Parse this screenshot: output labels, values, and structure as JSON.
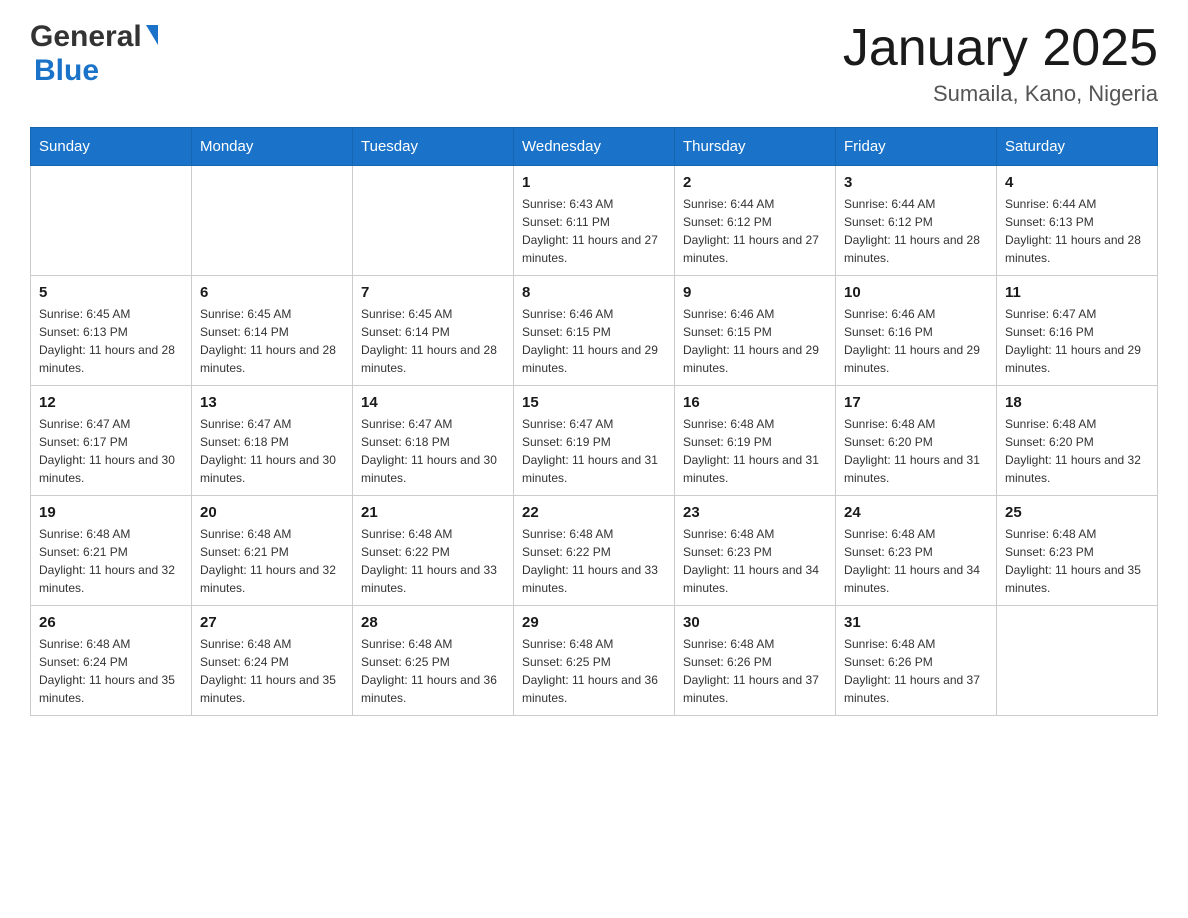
{
  "header": {
    "logo_general": "General",
    "logo_blue": "Blue",
    "month_title": "January 2025",
    "location": "Sumaila, Kano, Nigeria"
  },
  "days_of_week": [
    "Sunday",
    "Monday",
    "Tuesday",
    "Wednesday",
    "Thursday",
    "Friday",
    "Saturday"
  ],
  "weeks": [
    [
      {
        "day": "",
        "info": ""
      },
      {
        "day": "",
        "info": ""
      },
      {
        "day": "",
        "info": ""
      },
      {
        "day": "1",
        "info": "Sunrise: 6:43 AM\nSunset: 6:11 PM\nDaylight: 11 hours and 27 minutes."
      },
      {
        "day": "2",
        "info": "Sunrise: 6:44 AM\nSunset: 6:12 PM\nDaylight: 11 hours and 27 minutes."
      },
      {
        "day": "3",
        "info": "Sunrise: 6:44 AM\nSunset: 6:12 PM\nDaylight: 11 hours and 28 minutes."
      },
      {
        "day": "4",
        "info": "Sunrise: 6:44 AM\nSunset: 6:13 PM\nDaylight: 11 hours and 28 minutes."
      }
    ],
    [
      {
        "day": "5",
        "info": "Sunrise: 6:45 AM\nSunset: 6:13 PM\nDaylight: 11 hours and 28 minutes."
      },
      {
        "day": "6",
        "info": "Sunrise: 6:45 AM\nSunset: 6:14 PM\nDaylight: 11 hours and 28 minutes."
      },
      {
        "day": "7",
        "info": "Sunrise: 6:45 AM\nSunset: 6:14 PM\nDaylight: 11 hours and 28 minutes."
      },
      {
        "day": "8",
        "info": "Sunrise: 6:46 AM\nSunset: 6:15 PM\nDaylight: 11 hours and 29 minutes."
      },
      {
        "day": "9",
        "info": "Sunrise: 6:46 AM\nSunset: 6:15 PM\nDaylight: 11 hours and 29 minutes."
      },
      {
        "day": "10",
        "info": "Sunrise: 6:46 AM\nSunset: 6:16 PM\nDaylight: 11 hours and 29 minutes."
      },
      {
        "day": "11",
        "info": "Sunrise: 6:47 AM\nSunset: 6:16 PM\nDaylight: 11 hours and 29 minutes."
      }
    ],
    [
      {
        "day": "12",
        "info": "Sunrise: 6:47 AM\nSunset: 6:17 PM\nDaylight: 11 hours and 30 minutes."
      },
      {
        "day": "13",
        "info": "Sunrise: 6:47 AM\nSunset: 6:18 PM\nDaylight: 11 hours and 30 minutes."
      },
      {
        "day": "14",
        "info": "Sunrise: 6:47 AM\nSunset: 6:18 PM\nDaylight: 11 hours and 30 minutes."
      },
      {
        "day": "15",
        "info": "Sunrise: 6:47 AM\nSunset: 6:19 PM\nDaylight: 11 hours and 31 minutes."
      },
      {
        "day": "16",
        "info": "Sunrise: 6:48 AM\nSunset: 6:19 PM\nDaylight: 11 hours and 31 minutes."
      },
      {
        "day": "17",
        "info": "Sunrise: 6:48 AM\nSunset: 6:20 PM\nDaylight: 11 hours and 31 minutes."
      },
      {
        "day": "18",
        "info": "Sunrise: 6:48 AM\nSunset: 6:20 PM\nDaylight: 11 hours and 32 minutes."
      }
    ],
    [
      {
        "day": "19",
        "info": "Sunrise: 6:48 AM\nSunset: 6:21 PM\nDaylight: 11 hours and 32 minutes."
      },
      {
        "day": "20",
        "info": "Sunrise: 6:48 AM\nSunset: 6:21 PM\nDaylight: 11 hours and 32 minutes."
      },
      {
        "day": "21",
        "info": "Sunrise: 6:48 AM\nSunset: 6:22 PM\nDaylight: 11 hours and 33 minutes."
      },
      {
        "day": "22",
        "info": "Sunrise: 6:48 AM\nSunset: 6:22 PM\nDaylight: 11 hours and 33 minutes."
      },
      {
        "day": "23",
        "info": "Sunrise: 6:48 AM\nSunset: 6:23 PM\nDaylight: 11 hours and 34 minutes."
      },
      {
        "day": "24",
        "info": "Sunrise: 6:48 AM\nSunset: 6:23 PM\nDaylight: 11 hours and 34 minutes."
      },
      {
        "day": "25",
        "info": "Sunrise: 6:48 AM\nSunset: 6:23 PM\nDaylight: 11 hours and 35 minutes."
      }
    ],
    [
      {
        "day": "26",
        "info": "Sunrise: 6:48 AM\nSunset: 6:24 PM\nDaylight: 11 hours and 35 minutes."
      },
      {
        "day": "27",
        "info": "Sunrise: 6:48 AM\nSunset: 6:24 PM\nDaylight: 11 hours and 35 minutes."
      },
      {
        "day": "28",
        "info": "Sunrise: 6:48 AM\nSunset: 6:25 PM\nDaylight: 11 hours and 36 minutes."
      },
      {
        "day": "29",
        "info": "Sunrise: 6:48 AM\nSunset: 6:25 PM\nDaylight: 11 hours and 36 minutes."
      },
      {
        "day": "30",
        "info": "Sunrise: 6:48 AM\nSunset: 6:26 PM\nDaylight: 11 hours and 37 minutes."
      },
      {
        "day": "31",
        "info": "Sunrise: 6:48 AM\nSunset: 6:26 PM\nDaylight: 11 hours and 37 minutes."
      },
      {
        "day": "",
        "info": ""
      }
    ]
  ]
}
